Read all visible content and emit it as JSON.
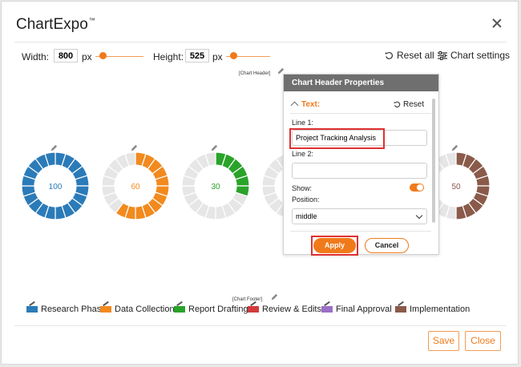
{
  "window": {
    "title": "ChartExpo",
    "title_tm": "™"
  },
  "toolbar": {
    "width_label": "Width:",
    "width_value": "800",
    "width_unit": "px",
    "height_label": "Height:",
    "height_value": "525",
    "height_unit": "px",
    "reset_all": "Reset all",
    "chart_settings": "Chart settings"
  },
  "chart": {
    "header_label": "[Chart Header]",
    "footer_label": "[Chart Footer]",
    "donuts": [
      {
        "label": "100",
        "color": "#2b7bb9",
        "filled": 1.0
      },
      {
        "label": "60",
        "color": "#f28a1e",
        "filled": 0.6
      },
      {
        "label": "30",
        "color": "#2aa32a",
        "filled": 0.3
      },
      {
        "label": "",
        "color": "#d23a3a",
        "filled": 0.0
      },
      {
        "label": "50",
        "color": "#8a5a4a",
        "filled": 0.5
      }
    ],
    "legend": [
      {
        "label": "Research Phase",
        "color": "#2b7bb9"
      },
      {
        "label": "Data Collection",
        "color": "#f28a1e"
      },
      {
        "label": "Report Drafting",
        "color": "#2aa32a"
      },
      {
        "label": "Review & Edits",
        "color": "#d23a3a"
      },
      {
        "label": "Final Approval",
        "color": "#9a6fc7"
      },
      {
        "label": "Implementation",
        "color": "#8a5a4a"
      }
    ]
  },
  "panel": {
    "title": "Chart Header Properties",
    "section": "Text:",
    "reset": "Reset",
    "line1_label": "Line 1:",
    "line1_value": "Project Tracking Analysis",
    "line2_label": "Line 2:",
    "line2_value": "",
    "show_label": "Show:",
    "position_label": "Position:",
    "position_value": "middle",
    "apply": "Apply",
    "cancel": "Cancel",
    "accent": "#f07a1a"
  },
  "footer": {
    "save": "Save",
    "close": "Close"
  }
}
